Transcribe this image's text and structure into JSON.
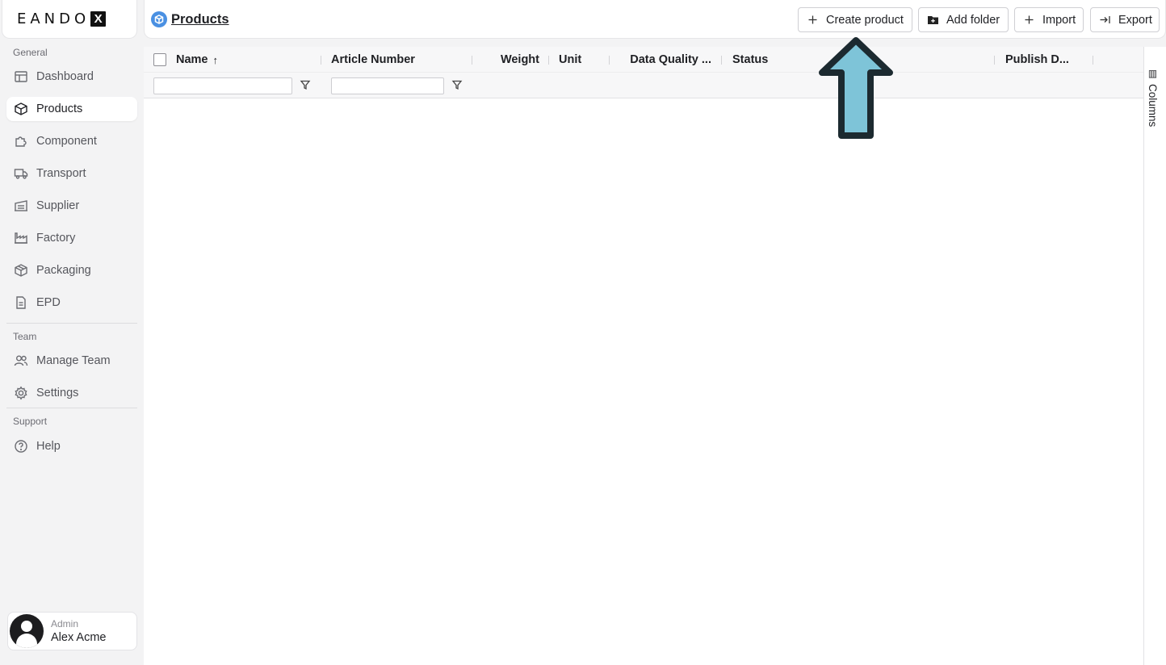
{
  "brand": {
    "logo_text": "EANDO",
    "logo_mark": "X"
  },
  "sidebar": {
    "sections": [
      {
        "title": "General"
      },
      {
        "title": "Team"
      },
      {
        "title": "Support"
      }
    ],
    "items": [
      {
        "label": "Dashboard",
        "icon": "dashboard-icon"
      },
      {
        "label": "Products",
        "icon": "box-icon",
        "active": true
      },
      {
        "label": "Component",
        "icon": "puzzle-icon"
      },
      {
        "label": "Transport",
        "icon": "truck-icon"
      },
      {
        "label": "Supplier",
        "icon": "warehouse-icon"
      },
      {
        "label": "Factory",
        "icon": "factory-icon"
      },
      {
        "label": "Packaging",
        "icon": "package-icon"
      },
      {
        "label": "EPD",
        "icon": "document-icon"
      },
      {
        "label": "Manage Team",
        "icon": "users-icon"
      },
      {
        "label": "Settings",
        "icon": "gear-icon"
      },
      {
        "label": "Help",
        "icon": "help-icon"
      }
    ],
    "user": {
      "role": "Admin",
      "name": "Alex Acme"
    }
  },
  "header": {
    "title": "Products",
    "buttons": {
      "create": "Create product",
      "add_folder": "Add folder",
      "import": "Import",
      "export": "Export"
    }
  },
  "table": {
    "columns": {
      "name": "Name",
      "article_number": "Article Number",
      "weight": "Weight",
      "unit": "Unit",
      "data_quality": "Data Quality ...",
      "status": "Status",
      "publish_date": "Publish D..."
    },
    "sort_indicator": "↑",
    "rows": []
  },
  "side_panel": {
    "columns_label": "Columns"
  },
  "colors": {
    "accent_arrow": "#7ec4d8",
    "arrow_outline": "#1c2a30",
    "breadcrumb_icon": "#4a90e2"
  }
}
